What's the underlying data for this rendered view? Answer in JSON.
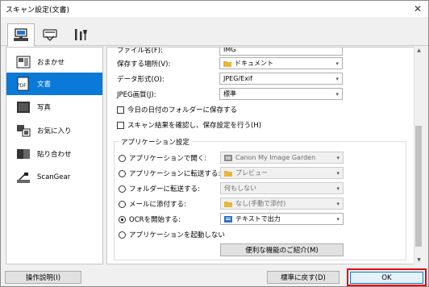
{
  "window": {
    "title": "スキャン設定(文書)"
  },
  "tabs": [
    {
      "name": "scan-from-computer",
      "active": true
    },
    {
      "name": "scan-from-panel",
      "active": false
    },
    {
      "name": "general-settings",
      "active": false
    }
  ],
  "sidebar": {
    "items": [
      {
        "label": "おまかせ",
        "icon": "auto-icon",
        "active": false
      },
      {
        "label": "文書",
        "icon": "document-icon",
        "active": true
      },
      {
        "label": "写真",
        "icon": "photo-icon",
        "active": false
      },
      {
        "label": "お気に入り",
        "icon": "favorites-icon",
        "active": false
      },
      {
        "label": "貼り合わせ",
        "icon": "stitch-icon",
        "active": false
      },
      {
        "label": "ScanGear",
        "icon": "scangear-icon",
        "active": false
      }
    ]
  },
  "settings": {
    "filename_label": "ファイル名(F):",
    "filename_value": "IMG",
    "save_in_label": "保存する場所(V):",
    "save_in_value": "ドキュメント",
    "format_label": "データ形式(O):",
    "format_value": "JPEG/Exif",
    "jpeg_quality_label": "JPEG画質(J):",
    "jpeg_quality_value": "標準",
    "subfolder_label": "今日の日付のフォルダーに保存する",
    "confirm_label": "スキャン結果を確認し、保存設定を行う(H)"
  },
  "app_settings": {
    "title": "アプリケーション設定",
    "options": [
      {
        "label": "アプリケーションで開く:",
        "value": "Canon My Image Garden",
        "selected": false,
        "enabled": false,
        "icon": "app-icon"
      },
      {
        "label": "アプリケーションに転送する:",
        "value": "プレビュー",
        "selected": false,
        "enabled": false,
        "icon": "folder-icon"
      },
      {
        "label": "フォルダーに転送する:",
        "value": "何もしない",
        "selected": false,
        "enabled": false,
        "icon": ""
      },
      {
        "label": "メールに添付する:",
        "value": "なし(手動で添付)",
        "selected": false,
        "enabled": false,
        "icon": "folder-icon"
      },
      {
        "label": "OCRを開始する:",
        "value": "テキストで出力",
        "selected": true,
        "enabled": true,
        "icon": "ocr-icon"
      },
      {
        "label": "アプリケーションを起動しない",
        "value": "",
        "selected": false,
        "enabled": true,
        "icon": ""
      }
    ],
    "more_functions_label": "便利な機能のご紹介(M)"
  },
  "footer": {
    "instructions_label": "操作説明(I)",
    "defaults_label": "標準に戻す(D)",
    "ok_label": "OK"
  },
  "colors": {
    "accent": "#0a79d8",
    "highlight_outline": "#e00000"
  }
}
